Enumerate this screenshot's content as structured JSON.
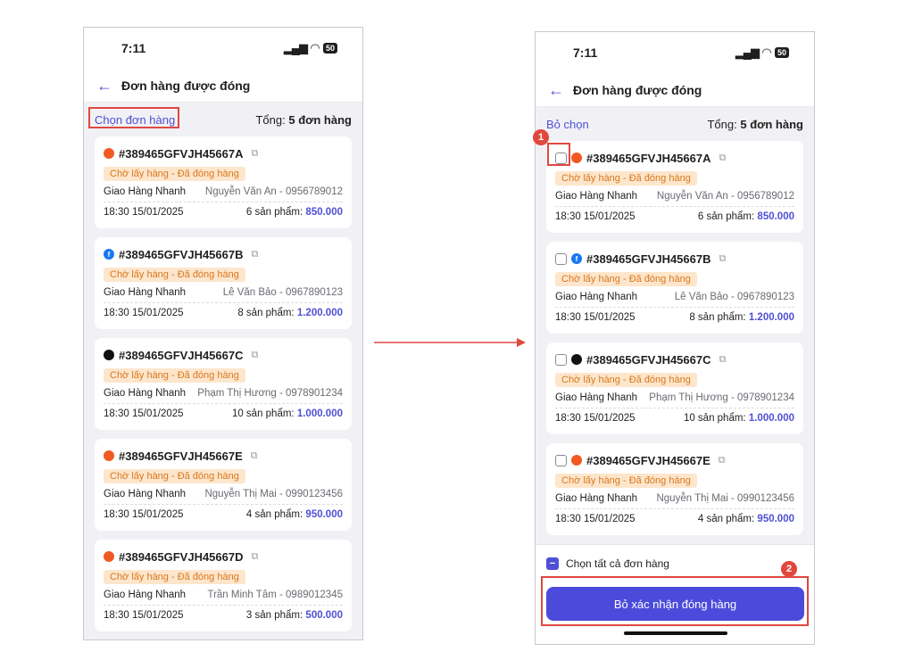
{
  "common": {
    "time": "7:11",
    "battery": "50",
    "nav_title": "Đơn hàng được đóng",
    "total_label": "Tổng:",
    "total_value": "5 đơn hàng",
    "status_tag": "Chờ lấy hàng - Đã đóng hàng",
    "carrier": "Giao Hàng Nhanh",
    "datetime": "18:30 15/01/2025"
  },
  "left": {
    "action_link": "Chọn đơn hàng"
  },
  "right": {
    "action_link": "Bỏ chọn",
    "select_all_label": "Chọn tất cả đơn hàng",
    "primary_button": "Bỏ xác nhận đóng hàng",
    "badge_1": "1",
    "badge_2": "2"
  },
  "orders": [
    {
      "channel": "shopee-icon",
      "id": "#389465GFVJH45667A",
      "receiver": "Nguyễn Văn An - 0956789012",
      "items": "6 sản phẩm:",
      "price": "850.000"
    },
    {
      "channel": "facebook-icon",
      "id": "#389465GFVJH45667B",
      "receiver": "Lê Văn Bảo - 0967890123",
      "items": "8 sản phẩm:",
      "price": "1.200.000"
    },
    {
      "channel": "tiktok-icon",
      "id": "#389465GFVJH45667C",
      "receiver": "Phạm Thị Hương - 0978901234",
      "items": "10 sản phẩm:",
      "price": "1.000.000"
    },
    {
      "channel": "shopee-icon",
      "id": "#389465GFVJH45667E",
      "receiver": "Nguyễn Thị Mai - 0990123456",
      "items": "4 sản phẩm:",
      "price": "950.000"
    },
    {
      "channel": "shopee-icon",
      "id": "#389465GFVJH45667D",
      "receiver": "Trần Minh Tâm - 0989012345",
      "items": "3 sản phẩm:",
      "price": "500.000"
    }
  ],
  "colors": {
    "accent": "#4f4fd6",
    "tag_bg": "#fde6cc",
    "tag_fg": "#d9781e",
    "highlight": "#e0483e"
  }
}
